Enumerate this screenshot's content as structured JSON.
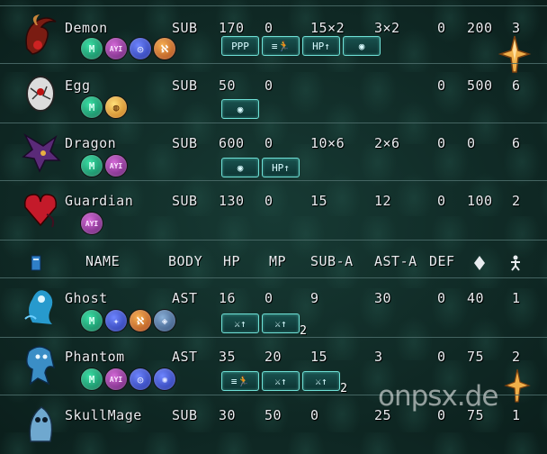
{
  "header": {
    "name": "NAME",
    "body": "BODY",
    "hp": "HP",
    "mp": "MP",
    "sub_a": "SUB-A",
    "ast_a": "AST-A",
    "def": "DEF",
    "diamond_icon": "diamond-icon",
    "figure_icon": "person-icon",
    "column_icon": "book-icon"
  },
  "rows": [
    {
      "name": "Demon",
      "body": "SUB",
      "hp": "170",
      "mp": "0",
      "sub_a": "15×2",
      "ast_a": "3×2",
      "def": "0",
      "mov": "200",
      "range": "3",
      "badges": [
        {
          "icon": "m-badge-icon",
          "text": "M"
        },
        {
          "icon": "ayi-badge-icon",
          "text": "AYI"
        },
        {
          "icon": "blue-swirl-icon",
          "text": "◎"
        },
        {
          "icon": "orange-rune-icon",
          "text": "ℵ"
        }
      ],
      "skills": [
        {
          "icon": "triple-p-icon",
          "text": "PPP"
        },
        {
          "icon": "run-icon",
          "text": "≡🏃"
        },
        {
          "icon": "hp-up-icon",
          "text": "HP↑"
        },
        {
          "icon": "eye-icon",
          "text": "◉"
        }
      ]
    },
    {
      "name": "Egg",
      "body": "SUB",
      "hp": "50",
      "mp": "0",
      "sub_a": "",
      "ast_a": "",
      "def": "0",
      "mov": "500",
      "range": "6",
      "badges": [
        {
          "icon": "m-badge-icon",
          "text": "M"
        },
        {
          "icon": "egg-badge-icon",
          "text": "◍"
        }
      ],
      "skills": [
        {
          "icon": "eye-icon",
          "text": "◉"
        }
      ]
    },
    {
      "name": "Dragon",
      "body": "SUB",
      "hp": "600",
      "mp": "0",
      "sub_a": "10×6",
      "ast_a": "2×6",
      "def": "0",
      "mov": "0",
      "range": "6",
      "badges": [
        {
          "icon": "m-badge-icon",
          "text": "M"
        },
        {
          "icon": "ayi-badge-icon",
          "text": "AYI"
        }
      ],
      "skills": [
        {
          "icon": "eye-icon",
          "text": "◉"
        },
        {
          "icon": "hp-up-icon",
          "text": "HP↑"
        }
      ]
    },
    {
      "name": "Guardian",
      "body": "SUB",
      "hp": "130",
      "mp": "0",
      "sub_a": "15",
      "ast_a": "12",
      "def": "0",
      "mov": "100",
      "range": "2",
      "badges": [
        {
          "icon": "ayi-badge-icon",
          "text": "AYI"
        }
      ],
      "skills": []
    },
    {
      "name": "Ghost",
      "body": "AST",
      "hp": "16",
      "mp": "0",
      "sub_a": "9",
      "ast_a": "30",
      "def": "0",
      "mov": "40",
      "range": "1",
      "badges": [
        {
          "icon": "m-badge-icon",
          "text": "M"
        },
        {
          "icon": "blue-flame-icon",
          "text": "✦"
        },
        {
          "icon": "orange-rune-icon",
          "text": "ℵ"
        },
        {
          "icon": "shield-badge-icon",
          "text": "◈"
        }
      ],
      "skills": [
        {
          "icon": "sword-up-icon",
          "text": "⚔↑"
        },
        {
          "icon": "sword-up-icon",
          "text": "⚔↑",
          "num": "2"
        }
      ]
    },
    {
      "name": "Phantom",
      "body": "AST",
      "hp": "35",
      "mp": "20",
      "sub_a": "15",
      "ast_a": "3",
      "def": "0",
      "mov": "75",
      "range": "2",
      "badges": [
        {
          "icon": "m-badge-icon",
          "text": "M"
        },
        {
          "icon": "ayi-badge-icon",
          "text": "AYI"
        },
        {
          "icon": "blue-swirl-icon",
          "text": "◎"
        },
        {
          "icon": "blue-burst-icon",
          "text": "✺"
        }
      ],
      "skills": [
        {
          "icon": "run-icon",
          "text": "≡🏃"
        },
        {
          "icon": "sword-up-icon",
          "text": "⚔↑"
        },
        {
          "icon": "sword-up-icon",
          "text": "⚔↑",
          "num": "2"
        }
      ]
    },
    {
      "name": "SkullMage",
      "body": "SUB",
      "hp": "30",
      "mp": "50",
      "sub_a": "0",
      "ast_a": "25",
      "def": "0",
      "mov": "75",
      "range": "1",
      "badges": [],
      "skills": []
    }
  ],
  "watermark": "onpsx.de",
  "colors": {
    "accent": "#6ee0d6",
    "bg": "#0f2824",
    "line": "#4a6a68"
  }
}
